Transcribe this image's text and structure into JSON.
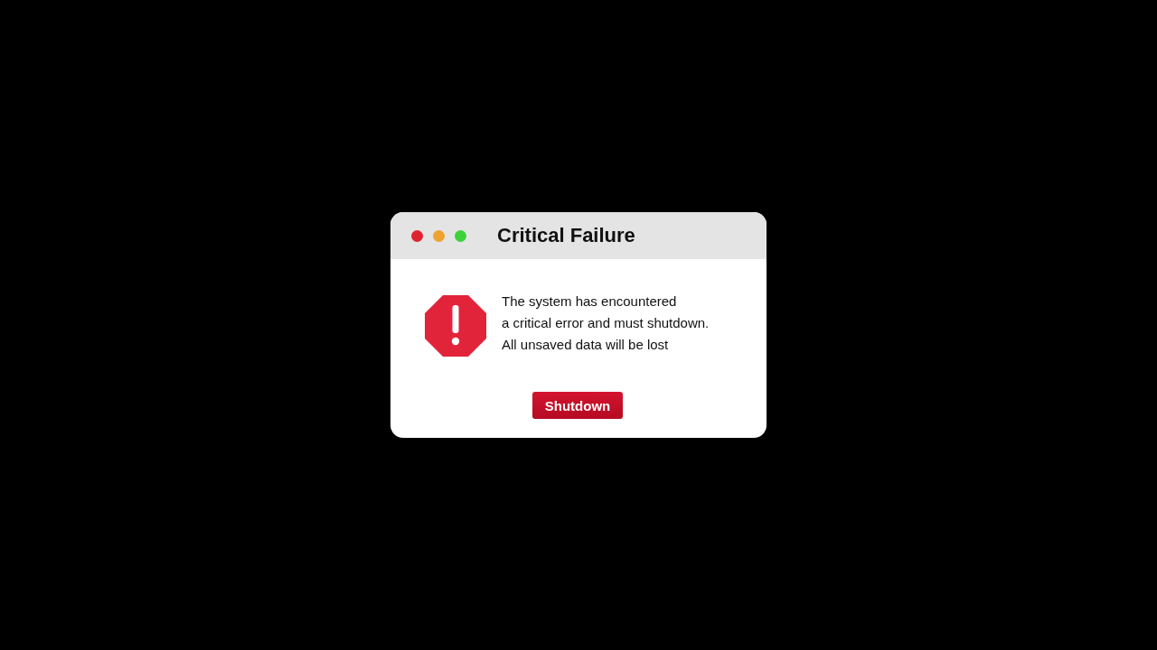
{
  "window": {
    "title": "Critical Failure",
    "controls": [
      {
        "color": "#e0242f"
      },
      {
        "color": "#f0a22e"
      },
      {
        "color": "#3cd23a"
      }
    ]
  },
  "message": {
    "lines": [
      "The system has encountered",
      "a critical error and must shutdown.",
      "All unsaved data will be lost"
    ]
  },
  "buttons": [
    {
      "label": "Shutdown"
    }
  ]
}
